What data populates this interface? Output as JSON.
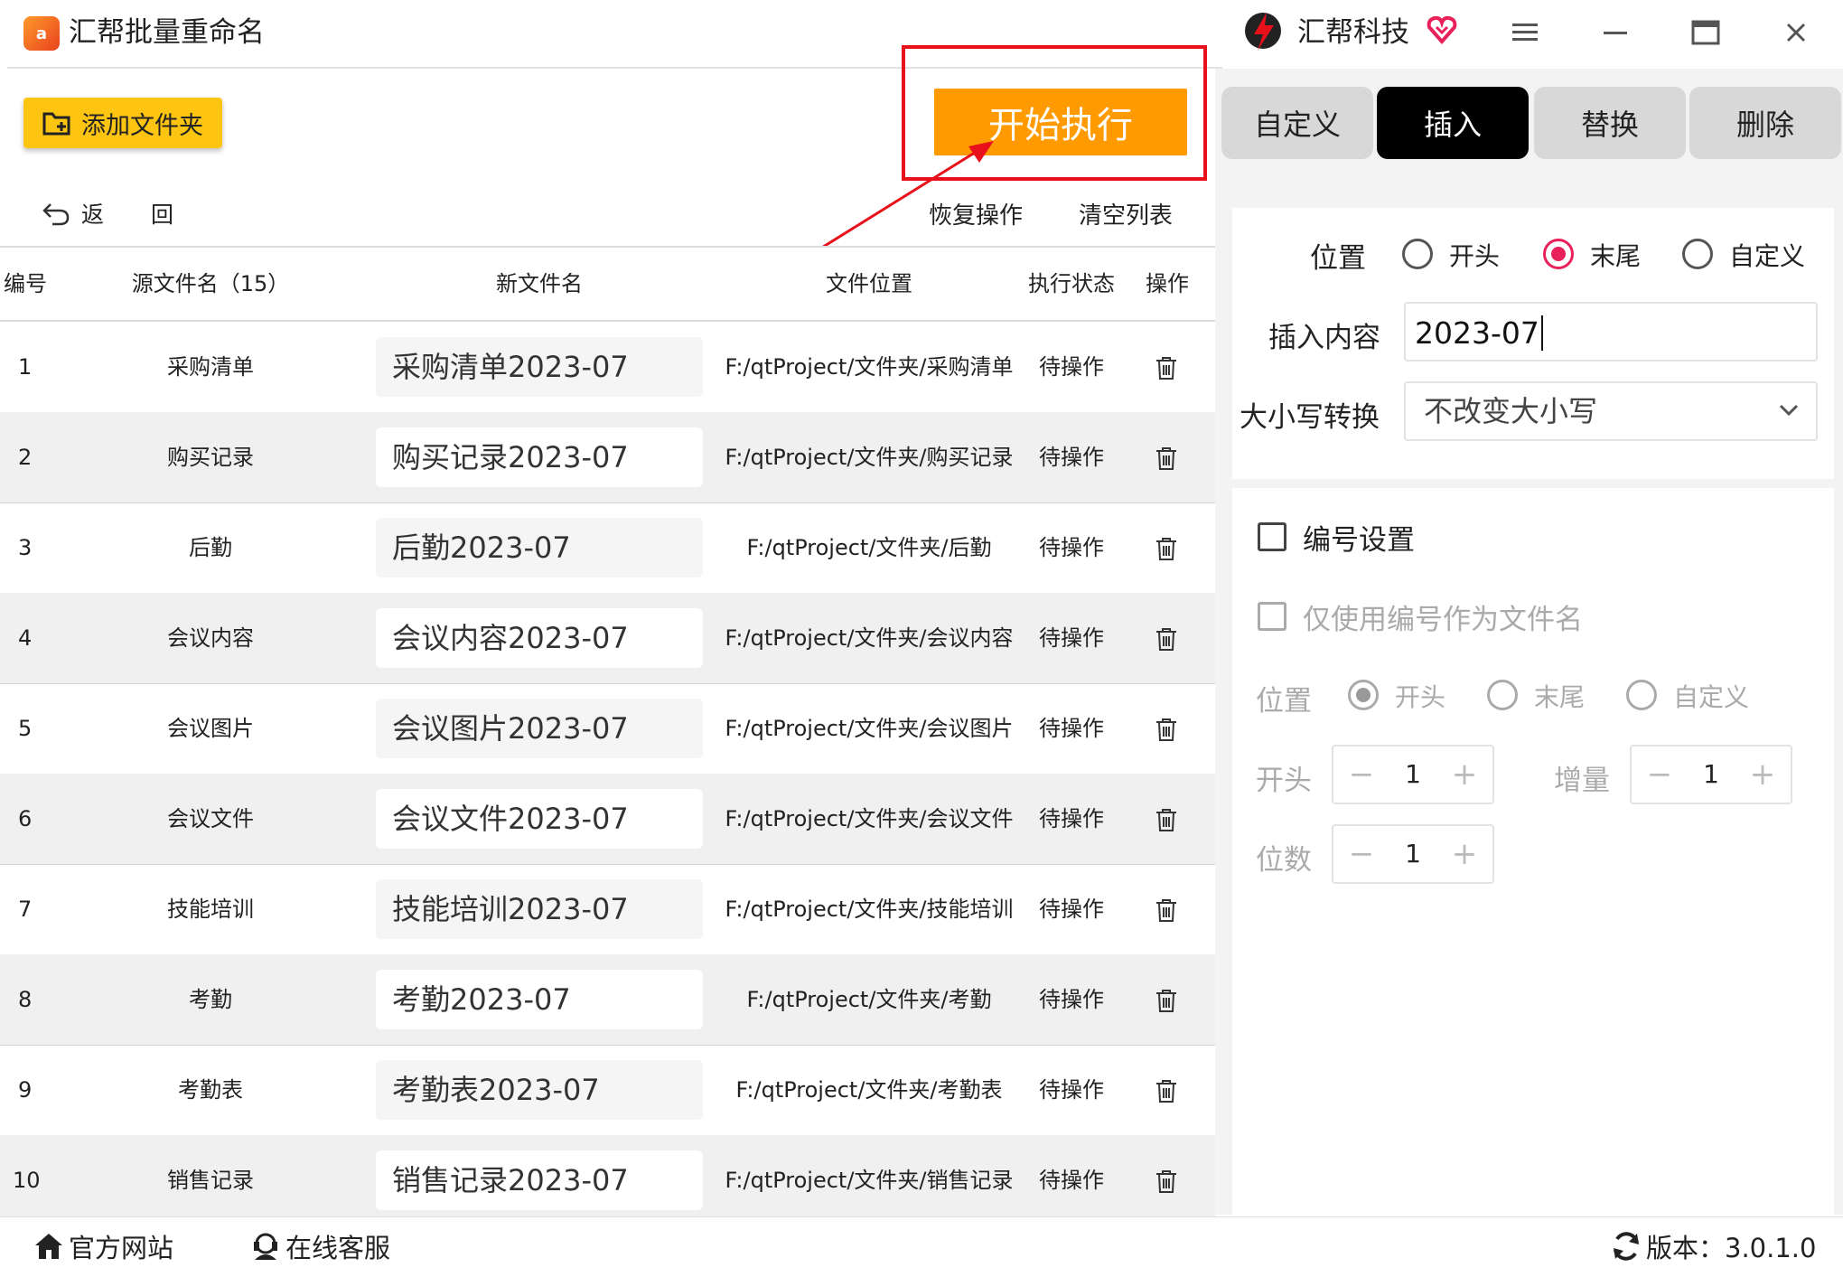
{
  "window": {
    "title": "汇帮批量重命名",
    "logo_text": "a",
    "brand_name": "汇帮科技"
  },
  "toolbar": {
    "add_folder_label": "添加文件夹",
    "start_label": "开始执行",
    "back_label": "返 回",
    "restore_label": "恢复操作",
    "clear_label": "清空列表"
  },
  "table": {
    "headers": [
      "编号",
      "源文件名（15）",
      "新文件名",
      "文件位置",
      "执行状态",
      "操作"
    ],
    "rows": [
      {
        "id": "1",
        "src": "采购清单",
        "new": "采购清单2023-07",
        "path": "F:/qtProject/文件夹/采购清单",
        "status": "待操作"
      },
      {
        "id": "2",
        "src": "购买记录",
        "new": "购买记录2023-07",
        "path": "F:/qtProject/文件夹/购买记录",
        "status": "待操作"
      },
      {
        "id": "3",
        "src": "后勤",
        "new": "后勤2023-07",
        "path": "F:/qtProject/文件夹/后勤",
        "status": "待操作"
      },
      {
        "id": "4",
        "src": "会议内容",
        "new": "会议内容2023-07",
        "path": "F:/qtProject/文件夹/会议内容",
        "status": "待操作"
      },
      {
        "id": "5",
        "src": "会议图片",
        "new": "会议图片2023-07",
        "path": "F:/qtProject/文件夹/会议图片",
        "status": "待操作"
      },
      {
        "id": "6",
        "src": "会议文件",
        "new": "会议文件2023-07",
        "path": "F:/qtProject/文件夹/会议文件",
        "status": "待操作"
      },
      {
        "id": "7",
        "src": "技能培训",
        "new": "技能培训2023-07",
        "path": "F:/qtProject/文件夹/技能培训",
        "status": "待操作"
      },
      {
        "id": "8",
        "src": "考勤",
        "new": "考勤2023-07",
        "path": "F:/qtProject/文件夹/考勤",
        "status": "待操作"
      },
      {
        "id": "9",
        "src": "考勤表",
        "new": "考勤表2023-07",
        "path": "F:/qtProject/文件夹/考勤表",
        "status": "待操作"
      },
      {
        "id": "10",
        "src": "销售记录",
        "new": "销售记录2023-07",
        "path": "F:/qtProject/文件夹/销售记录",
        "status": "待操作"
      }
    ]
  },
  "tabs": [
    {
      "label": "自定义",
      "active": false
    },
    {
      "label": "插入",
      "active": true
    },
    {
      "label": "替换",
      "active": false
    },
    {
      "label": "删除",
      "active": false
    }
  ],
  "insert": {
    "position_label": "位置",
    "position_options": [
      "开头",
      "末尾",
      "自定义"
    ],
    "position_selected": "末尾",
    "content_label": "插入内容",
    "content_value": "2023-07",
    "case_label": "大小写转换",
    "case_value": "不改变大小写"
  },
  "numbering": {
    "enable_label": "编号设置",
    "only_number_label": "仅使用编号作为文件名",
    "position_label": "位置",
    "position_options": [
      "开头",
      "末尾",
      "自定义"
    ],
    "position_selected": "开头",
    "start_label": "开头",
    "start_value": "1",
    "increment_label": "增量",
    "increment_value": "1",
    "digits_label": "位数",
    "digits_value": "1"
  },
  "footer": {
    "website_label": "官方网站",
    "service_label": "在线客服",
    "version_label": "版本：3.0.1.0"
  },
  "colors": {
    "accent_orange": "#ff9a00",
    "add_button_yellow": "#fdc411",
    "highlight_red": "#e8101a",
    "radio_pink": "#e8215a"
  }
}
